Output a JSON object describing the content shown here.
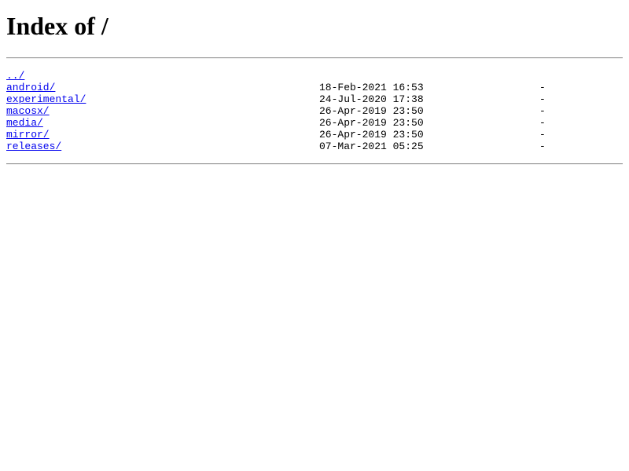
{
  "title": "Index of /",
  "parent": {
    "name": "../"
  },
  "entries": [
    {
      "name": "android/",
      "date": "18-Feb-2021 16:53",
      "size": "-"
    },
    {
      "name": "experimental/",
      "date": "24-Jul-2020 17:38",
      "size": "-"
    },
    {
      "name": "macosx/",
      "date": "26-Apr-2019 23:50",
      "size": "-"
    },
    {
      "name": "media/",
      "date": "26-Apr-2019 23:50",
      "size": "-"
    },
    {
      "name": "mirror/",
      "date": "26-Apr-2019 23:50",
      "size": "-"
    },
    {
      "name": "releases/",
      "date": "07-Mar-2021 05:25",
      "size": "-"
    }
  ],
  "colors": {
    "link": "#0000ee",
    "text": "#000000",
    "background": "#ffffff"
  }
}
